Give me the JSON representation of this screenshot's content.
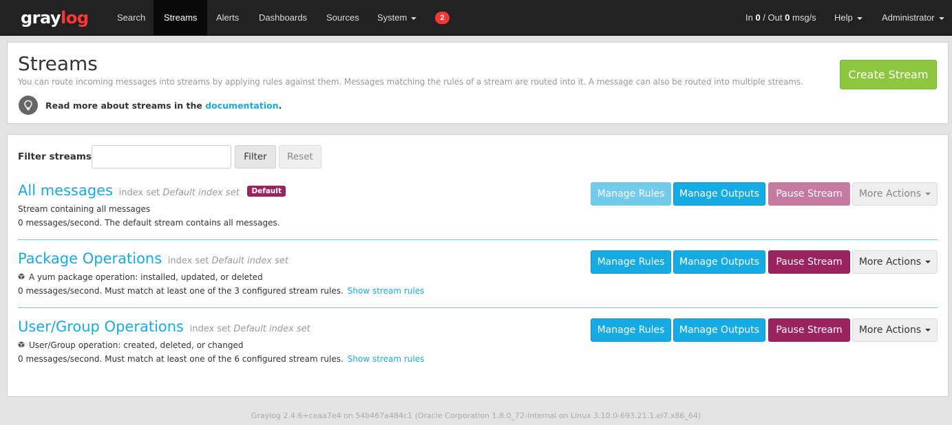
{
  "navbar": {
    "brand_gray": "gray",
    "brand_red": "log",
    "items": [
      {
        "label": "Search"
      },
      {
        "label": "Streams"
      },
      {
        "label": "Alerts"
      },
      {
        "label": "Dashboards"
      },
      {
        "label": "Sources"
      },
      {
        "label": "System"
      }
    ],
    "notifications_count": "2",
    "throughput": {
      "in_label": "In",
      "in_value": "0",
      "sep": "/ Out",
      "out_value": "0",
      "unit": "msg/s"
    },
    "help_label": "Help",
    "user_label": "Administrator"
  },
  "header": {
    "title": "Streams",
    "description": "You can route incoming messages into streams by applying rules against them. Messages matching the rules of a stream are routed into it. A message can also be routed into multiple streams.",
    "read_more_prefix": "Read more about streams in the",
    "read_more_link": "documentation",
    "read_more_suffix": ".",
    "create_button": "Create Stream"
  },
  "filter": {
    "label": "Filter streams",
    "input_value": "",
    "filter_button": "Filter",
    "reset_button": "Reset"
  },
  "streams": [
    {
      "name": "All messages",
      "index_set_label": "index set",
      "index_set_name": "Default index set",
      "badge": "Default",
      "description": "Stream containing all messages",
      "rate": "0 messages/second. The default stream contains all messages.",
      "show_rules": "",
      "manage_rules": "Manage Rules",
      "manage_outputs": "Manage Outputs",
      "pause": "Pause Stream",
      "more": "More Actions"
    },
    {
      "name": "Package Operations",
      "index_set_label": "index set",
      "index_set_name": "Default index set",
      "description": "A yum package operation: installed, updated, or deleted",
      "rate": "0 messages/second. Must match at least one of the 3 configured stream rules.",
      "show_rules": "Show stream rules",
      "manage_rules": "Manage Rules",
      "manage_outputs": "Manage Outputs",
      "pause": "Pause Stream",
      "more": "More Actions"
    },
    {
      "name": "User/Group Operations",
      "index_set_label": "index set",
      "index_set_name": "Default index set",
      "description": "User/Group operation: created, deleted, or changed",
      "rate": "0 messages/second. Must match at least one of the 6 configured stream rules.",
      "show_rules": "Show stream rules",
      "manage_rules": "Manage Rules",
      "manage_outputs": "Manage Outputs",
      "pause": "Pause Stream",
      "more": "More Actions"
    }
  ],
  "footer": "Graylog 2.4.6+ceaa7e4 on 54b467a484c1 (Oracle Corporation 1.8.0_72-internal on Linux 3.10.0-693.21.1.el7.x86_64)",
  "colors": {
    "brand_red": "#ff3633",
    "accent_blue": "#16ace3",
    "success_green": "#8dc63f",
    "pause_purple": "#9b2360"
  },
  "icons": {
    "read_more": "lightbulb-icon",
    "stream_description": "cube-icon"
  }
}
